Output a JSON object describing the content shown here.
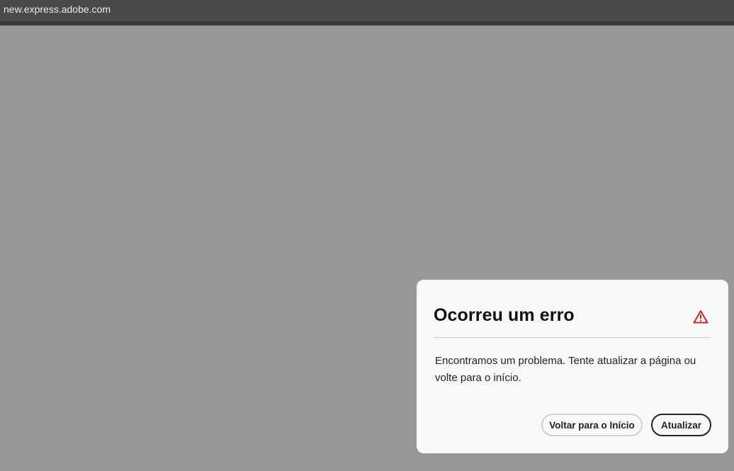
{
  "browser": {
    "url": "new.express.adobe.com"
  },
  "dialog": {
    "title": "Ocorreu um erro",
    "icon": "alert-triangle-icon",
    "icon_color": "#c9252c",
    "message": "Encontramos um problema. Tente atualizar a página ou volte para o início.",
    "secondary_button": "Voltar para o Início",
    "primary_button": "Atualizar"
  }
}
